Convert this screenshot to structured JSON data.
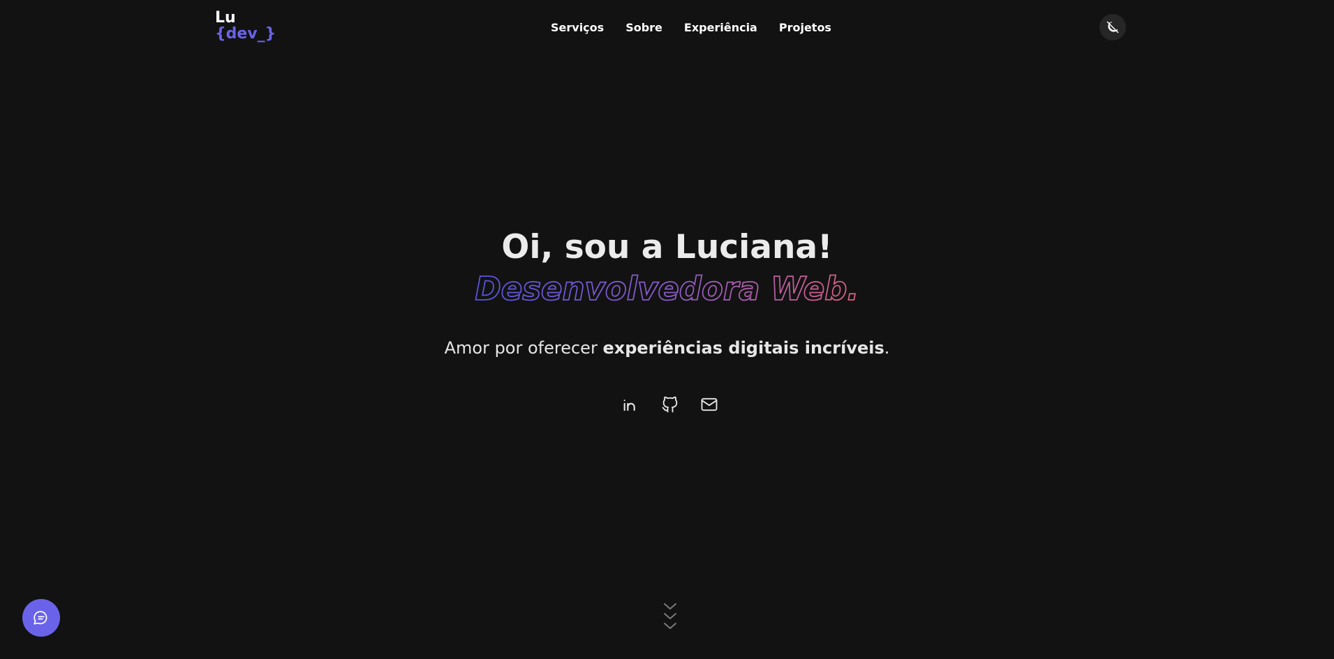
{
  "logo": {
    "line1": "Lu",
    "line2": "{dev_}"
  },
  "nav": {
    "items": [
      {
        "label": "Serviços"
      },
      {
        "label": "Sobre"
      },
      {
        "label": "Experiência"
      },
      {
        "label": "Projetos"
      }
    ]
  },
  "theme_toggle": {
    "icon": "moon-off-icon"
  },
  "hero": {
    "title": "Oi, sou a Luciana!",
    "role": "Desenvolvedora Web.",
    "description_prefix": "Amor por oferecer ",
    "description_highlight": "experiências digitais incríveis",
    "description_suffix": "."
  },
  "socials": [
    {
      "icon": "linkedin-icon"
    },
    {
      "icon": "github-icon"
    },
    {
      "icon": "mail-icon"
    }
  ],
  "scroll_indicator": {
    "icon": "chevrons-down-icon"
  },
  "chat": {
    "icon": "chat-bubble-icon"
  },
  "colors": {
    "background": "#121212",
    "accent": "#6a63e9",
    "gradient_end": "#e0607e",
    "text": "#ebebeb",
    "toggle_bg": "#262626"
  }
}
